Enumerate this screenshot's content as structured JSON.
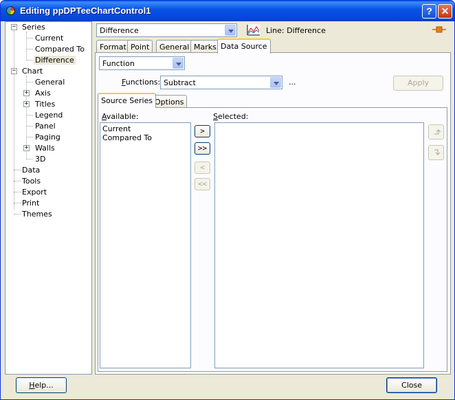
{
  "window": {
    "title": "Editing ppDPTeeChartControl1",
    "help_glyph": "?",
    "close_glyph": "✕"
  },
  "tree": {
    "series": "Series",
    "current": "Current",
    "compared_to": "Compared To",
    "difference": "Difference",
    "chart": "Chart",
    "general": "General",
    "axis": "Axis",
    "titles": "Titles",
    "legend": "Legend",
    "panel": "Panel",
    "paging": "Paging",
    "walls": "Walls",
    "threed": "3D",
    "data": "Data",
    "tools": "Tools",
    "export": "Export",
    "print": "Print",
    "themes": "Themes"
  },
  "series_selector": {
    "value": "Difference",
    "line_label": "Line: Difference"
  },
  "tabs": {
    "format": "Format",
    "point": "Point",
    "general": "General",
    "marks": "Marks",
    "data_source": "Data Source"
  },
  "data_source": {
    "source_type": "Function",
    "functions_label_pre": "F",
    "functions_label_post": "unctions:",
    "function_value": "Subtract",
    "ellipsis": "...",
    "apply_label": "Apply"
  },
  "subtabs": {
    "source_series": "Source Series",
    "options": "Options"
  },
  "source": {
    "available_pre": "A",
    "available_post": "vailable:",
    "selected_pre": "S",
    "selected_post": "elected:",
    "available_items": [
      "Current",
      "Compared To"
    ],
    "move_right": ">",
    "move_all_right": ">>",
    "move_left": "<",
    "move_all_left": "<<"
  },
  "footer": {
    "help_pre": "H",
    "help_post": "elp...",
    "close": "Close"
  },
  "colors": {
    "titlebar": "#0a54e6",
    "accent_tab": "#ffc83c",
    "marker": "#f08000"
  }
}
